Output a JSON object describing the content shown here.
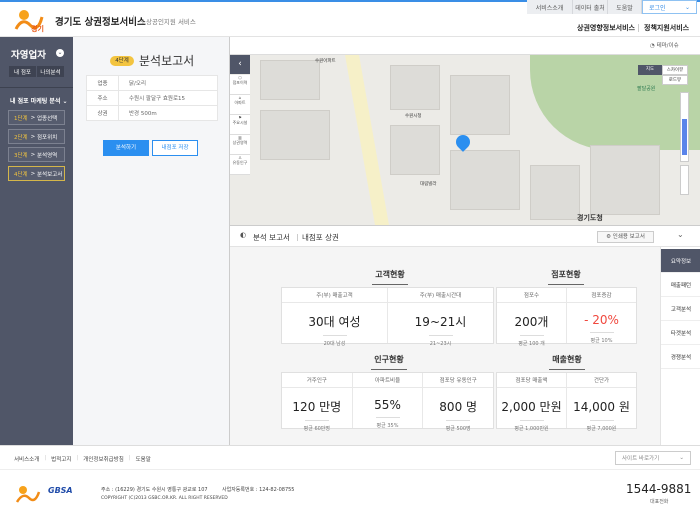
{
  "header": {
    "title": "경기도 상권정보서비스",
    "subtitle": "소상공인지원 서비스",
    "util": [
      "서비스소개",
      "데이터 출처",
      "도움말"
    ],
    "login": "로그인",
    "nav": [
      "상권영향정보서비스",
      "정책지원서비스"
    ]
  },
  "sidebar": {
    "title": "자영업자",
    "buttons": [
      "내 점포",
      "나의분석"
    ],
    "section": "내 점포 마케팅 분석",
    "steps": [
      {
        "n": "1단계",
        "label": "업종선택"
      },
      {
        "n": "2단계",
        "label": "점포위치"
      },
      {
        "n": "3단계",
        "label": "분석영역"
      },
      {
        "n": "4단계",
        "label": "분석보고서"
      }
    ]
  },
  "panel": {
    "badge": "4단계",
    "title": "분석보고서",
    "rows": [
      {
        "k": "업종",
        "v": "닭/오리"
      },
      {
        "k": "주소",
        "v": "수원시 팔달구 효원로15"
      },
      {
        "k": "상권",
        "v": "반경 500m"
      }
    ],
    "analyze": "분석하기",
    "save": "내점포 저장"
  },
  "map": {
    "theme": "테마/이슈",
    "tools": [
      "접포이력",
      "아파트",
      "주요시설",
      "상권영역",
      "유동인구"
    ],
    "types": [
      "지도",
      "스카이뷰",
      "로드뷰"
    ],
    "labels": [
      "수원아파트",
      "팔달공원",
      "경기도청",
      "수원시청",
      "대림빌라"
    ]
  },
  "report": {
    "title": "분석 보고서",
    "subtitle": "내점포 상권",
    "print": "인쇄용 보고서"
  },
  "tabs": [
    "요약정보",
    "매출패턴",
    "고객분석",
    "타겟분석",
    "경쟁분석"
  ],
  "sections": {
    "customer": {
      "title": "고객현황",
      "cells": [
        {
          "h": "주(부) 매출고객",
          "v": "30대 여성",
          "s": "20대 남성"
        },
        {
          "h": "주(부) 매출시간대",
          "v": "19~21시",
          "s": "21~23시"
        }
      ]
    },
    "store": {
      "title": "점포현황",
      "cells": [
        {
          "h": "점포수",
          "v": "200개",
          "s": "평균 100 개"
        },
        {
          "h": "점포증감",
          "v": "- 20%",
          "s": "평균 10%"
        }
      ]
    },
    "population": {
      "title": "인구현황",
      "cells": [
        {
          "h": "거주인구",
          "v": "120 만명",
          "s": "평균 60만명"
        },
        {
          "h": "아파트비율",
          "v": "55%",
          "s": "평균 35%"
        },
        {
          "h": "점포당 유동인구",
          "v": "800 명",
          "s": "평균 500명"
        }
      ]
    },
    "sales": {
      "title": "매출현황",
      "cells": [
        {
          "h": "점포당 매출액",
          "v": "2,000 만원",
          "s": "평균 1,000만원"
        },
        {
          "h": "건단가",
          "v": "14,000 원",
          "s": "평균 7,000원"
        }
      ]
    }
  },
  "footer": {
    "links": [
      "서비스소개",
      "법적고지",
      "개인정보취급방침",
      "도움말"
    ],
    "site": "사이트 바로가기",
    "address": "주소 : (16229) 경기도 수원시 영통구 광교로 107",
    "bizno": "사업자등록번호 : 124-82-08755",
    "copyright": "COPYRIGHT (C)2013 GSBC.OR.KR. ALL RIGHT RESERVED",
    "phone": "1544-9881",
    "phone_label": "대표전화",
    "logos": [
      "경기",
      "GBSA"
    ]
  },
  "colors": {
    "accent": "#2b8ff0",
    "sidebar": "#505668",
    "negative": "#f0483e",
    "badge": "#f3c43f"
  }
}
